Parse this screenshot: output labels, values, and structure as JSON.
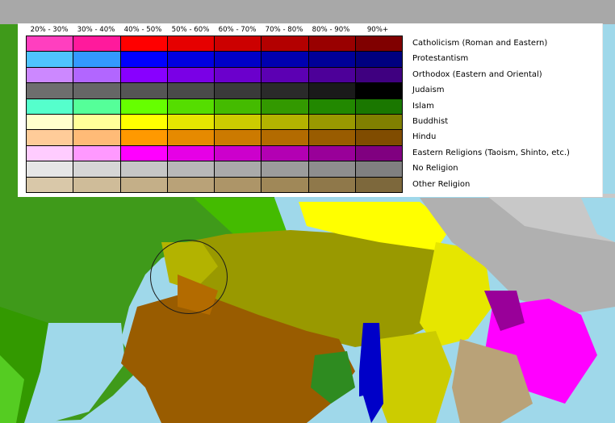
{
  "legend": {
    "columns": [
      "20% - 30%",
      "30% - 40%",
      "40% - 50%",
      "50% - 60%",
      "60% - 70%",
      "70% - 80%",
      "80% - 90%",
      "90%+"
    ],
    "rows": [
      {
        "label": "Catholicism (Roman and Eastern)",
        "colors": [
          "#ff3fbf",
          "#ff1a9c",
          "#ff0000",
          "#e60000",
          "#cc0000",
          "#b30000",
          "#990000",
          "#800000"
        ]
      },
      {
        "label": "Protestantism",
        "colors": [
          "#4fc3ff",
          "#3399ff",
          "#0000ff",
          "#0000e0",
          "#0000c8",
          "#0000b0",
          "#000098",
          "#000080"
        ]
      },
      {
        "label": "Orthodox (Eastern and Oriental)",
        "colors": [
          "#cc88ff",
          "#b266ff",
          "#8800ff",
          "#7a00e6",
          "#6b00cc",
          "#5c00b3",
          "#4d0099",
          "#3f0080"
        ]
      },
      {
        "label": "Judaism",
        "colors": [
          "#6e6e6e",
          "#666666",
          "#555555",
          "#4a4a4a",
          "#3a3a3a",
          "#2a2a2a",
          "#1a1a1a",
          "#000000"
        ]
      },
      {
        "label": "Islam",
        "colors": [
          "#55ffcc",
          "#55ff99",
          "#66ff00",
          "#55dd00",
          "#44bb00",
          "#339900",
          "#228800",
          "#1a7700"
        ]
      },
      {
        "label": "Buddhist",
        "colors": [
          "#ffffcc",
          "#ffff99",
          "#ffff00",
          "#e6e600",
          "#cccc00",
          "#b3b300",
          "#999900",
          "#808000"
        ]
      },
      {
        "label": "Hindu",
        "colors": [
          "#ffcc99",
          "#ffbb77",
          "#ff9900",
          "#e68a00",
          "#cc7a00",
          "#b36b00",
          "#995c00",
          "#804c00"
        ]
      },
      {
        "label": "Eastern Religions (Taoism, Shinto, etc.)",
        "colors": [
          "#ffccff",
          "#ff99ff",
          "#ff00ff",
          "#e600e6",
          "#cc00cc",
          "#b300b3",
          "#990099",
          "#800080"
        ]
      },
      {
        "label": "No Religion",
        "colors": [
          "#e6e6e6",
          "#d6d6d6",
          "#c6c6c6",
          "#b8b8b8",
          "#aaaaaa",
          "#9c9c9c",
          "#8e8e8e",
          "#808080"
        ]
      },
      {
        "label": "Other Religion",
        "colors": [
          "#d9c8a9",
          "#cfbc99",
          "#c4af88",
          "#b9a278",
          "#ad9568",
          "#a08858",
          "#8f784a",
          "#7d683c"
        ]
      }
    ]
  },
  "map": {
    "colors": {
      "ocean": "#9fd8ea",
      "islam": "#339900",
      "islam_light": "#44bb00",
      "buddhist": "#999900",
      "hindu": "#995c00",
      "no_religion": "#aaaaaa",
      "eastern": "#ff00ff",
      "protestant": "#0000c8",
      "other": "#b9a278"
    }
  }
}
